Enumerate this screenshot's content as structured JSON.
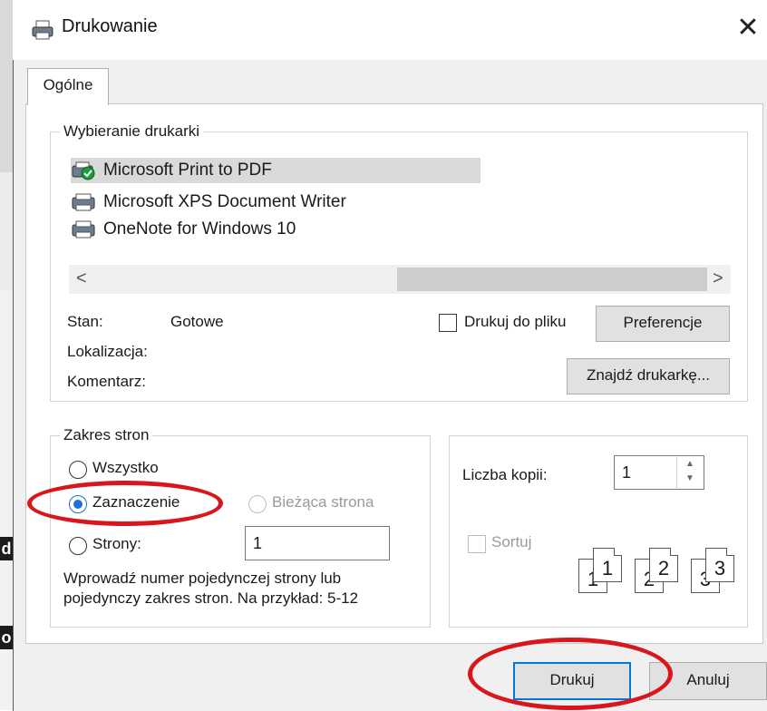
{
  "window": {
    "title": "Drukowanie",
    "close_glyph": "✕"
  },
  "background": {
    "fragment_1": "d",
    "fragment_2": "o"
  },
  "tabs": [
    {
      "label": "Ogólne"
    }
  ],
  "printer_section": {
    "title": "Wybieranie drukarki",
    "printers": [
      {
        "name": "Microsoft Print to PDF",
        "icon": "printer-default-icon",
        "selected": true
      },
      {
        "name": "Microsoft XPS Document Writer",
        "icon": "printer-icon",
        "selected": false
      },
      {
        "name": "OneNote for Windows 10",
        "icon": "printer-icon",
        "selected": false
      }
    ],
    "scroll_left": "<",
    "scroll_right": ">",
    "status_label": "Stan:",
    "status_value": "Gotowe",
    "location_label": "Lokalizacja:",
    "comment_label": "Komentarz:",
    "print_to_file_label": "Drukuj do pliku",
    "preferences_button": "Preferencje",
    "find_printer_button": "Znajdź drukarkę..."
  },
  "page_range": {
    "title": "Zakres stron",
    "all_label": "Wszystko",
    "selection_label": "Zaznaczenie",
    "current_page_label": "Bieżąca strona",
    "pages_label": "Strony:",
    "pages_value": "1",
    "hint_line1": "Wprowadź numer pojedynczej strony lub",
    "hint_line2": "pojedynczy zakres stron. Na przykład: 5-12",
    "selected_option": "selection"
  },
  "copies": {
    "label": "Liczba kopii:",
    "value": "1",
    "collate_label": "Sortuj",
    "collate_pages": [
      "1",
      "1",
      "2",
      "2",
      "3",
      "3"
    ]
  },
  "footer": {
    "print_button": "Drukuj",
    "cancel_button": "Anuluj"
  },
  "colors": {
    "highlight_ellipse": "#d8161b",
    "radio_selected": "#1e6fd9",
    "selected_row": "#d9d9d9"
  }
}
